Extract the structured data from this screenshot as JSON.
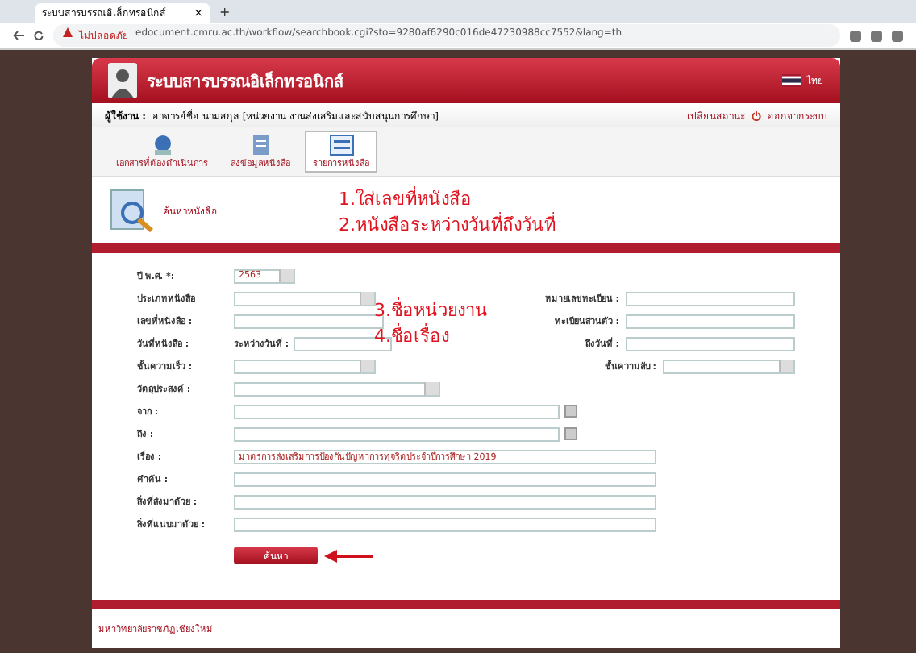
{
  "browser": {
    "tab_title": "ระบบสารบรรณอิเล็กทรอนิกส์",
    "tab_close": "×",
    "new_tab": "+",
    "security": "ไม่ปลอดภัย",
    "url": "edocument.cmru.ac.th/workflow/searchbook.cgi?sto=9280af6290c016de47230988cc7552&lang=th"
  },
  "app": {
    "title": "ระบบสารบรรณอิเล็กทรอนิกส์",
    "language": "ไทย",
    "user_label": "ผู้ใช้งาน :",
    "user_name": "อาจารย์ชื่อ นามสกุล [หน่วยงาน งานส่งเสริมและสนับสนุนการศึกษา]",
    "switch_role": "เปลี่ยนสถานะ",
    "logout": "ออกจากระบบ"
  },
  "nav": [
    {
      "label": "เอกสารที่ต้องดำเนินการ",
      "selected": false
    },
    {
      "label": "ลงข้อมูลหนังสือ",
      "selected": false
    },
    {
      "label": "รายการหนังสือ",
      "selected": true
    }
  ],
  "section_title": "ค้นหาหนังสือ",
  "annotations": [
    "1.ใส่เลขที่หนังสือ",
    "2.หนังสือระหว่างวันที่ถึงวันที่",
    "3.ชื่อหน่วยงาน",
    "4.ชื่อเรื่อง"
  ],
  "form": [
    {
      "label": "ปี พ.ศ. *:",
      "field": {
        "kind": "year",
        "value": "2563"
      }
    },
    {
      "label": "ประเภทหนังสือ",
      "field": {
        "kind": "select"
      },
      "right": {
        "label": "หมายเลขทะเบียน :",
        "field": {
          "kind": "text"
        }
      }
    },
    {
      "label": "เลขที่หนังสือ :",
      "field": {
        "kind": "text"
      },
      "right": {
        "label": "ทะเบียนส่วนตัว :",
        "field": {
          "kind": "text"
        }
      }
    },
    {
      "label": "วันที่หนังสือ :",
      "field": {
        "kind": "range",
        "prefix": "ระหว่างวันที่ :"
      },
      "right": {
        "label": "ถึงวันที่ :",
        "field": {
          "kind": "text"
        }
      }
    },
    {
      "label": "ชั้นความเร็ว :",
      "field": {
        "kind": "select"
      },
      "right": {
        "label": "ชั้นความลับ :",
        "field": {
          "kind": "select"
        }
      }
    },
    {
      "label": "วัตถุประสงค์ :",
      "field": {
        "kind": "wide-select"
      }
    },
    {
      "label": "จาก :",
      "field": {
        "kind": "lookup"
      }
    },
    {
      "label": "ถึง :",
      "field": {
        "kind": "lookup"
      }
    },
    {
      "label": "เรื่อง :",
      "field": {
        "kind": "long",
        "value": "มาตรการส่งเสริมการป้องกันปัญหาการทุจริตประจำปีการศึกษา 2019"
      }
    },
    {
      "label": "คำค้น :",
      "field": {
        "kind": "long"
      }
    },
    {
      "label": "สิ่งที่ส่งมาด้วย :",
      "field": {
        "kind": "long"
      }
    },
    {
      "label": "สิ่งที่แนบมาด้วย :",
      "field": {
        "kind": "long"
      }
    }
  ],
  "search_button": "ค้นหา",
  "footer": "มหาวิทยาลัยราชภัฏเชียงใหม่"
}
